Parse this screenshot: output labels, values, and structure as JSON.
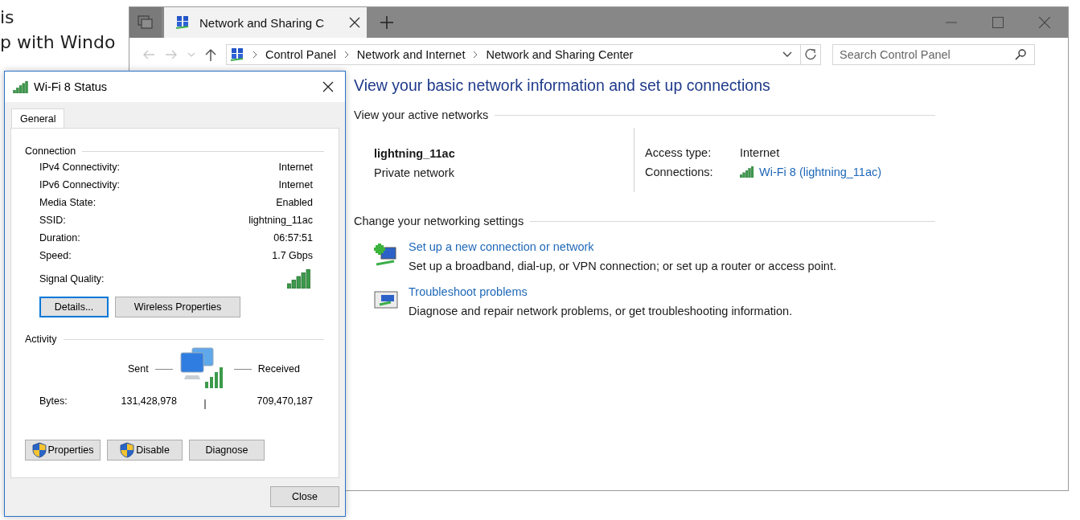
{
  "background_page": {
    "lines": [
      "is",
      "p with Windo"
    ]
  },
  "main_window": {
    "tabs": [
      {
        "label": "Network and Sharing C",
        "selected": true
      }
    ],
    "breadcrumbs": [
      "Control Panel",
      "Network and Internet",
      "Network and Sharing Center"
    ],
    "search": {
      "placeholder": "Search Control Panel"
    },
    "heading": "View your basic network information and set up connections",
    "active_networks": {
      "title": "View your active networks",
      "network_name": "lightning_11ac",
      "network_type": "Private network",
      "access_type_label": "Access type:",
      "access_type": "Internet",
      "connections_label": "Connections:",
      "connection_link": "Wi-Fi 8 (lightning_11ac)"
    },
    "settings": {
      "title": "Change your networking settings",
      "items": [
        {
          "kind": "new-connection",
          "link": "Set up a new connection or network",
          "description": "Set up a broadband, dial-up, or VPN connection; or set up a router or access point."
        },
        {
          "kind": "troubleshoot",
          "link": "Troubleshoot problems",
          "description": "Diagnose and repair network problems, or get troubleshooting information."
        }
      ]
    }
  },
  "status_dialog": {
    "title": "Wi-Fi 8 Status",
    "tabs": [
      {
        "label": "General",
        "selected": true
      }
    ],
    "connection": {
      "title": "Connection",
      "rows": [
        {
          "label": "IPv4 Connectivity:",
          "value": "Internet"
        },
        {
          "label": "IPv6 Connectivity:",
          "value": "Internet"
        },
        {
          "label": "Media State:",
          "value": "Enabled"
        },
        {
          "label": "SSID:",
          "value": "lightning_11ac"
        },
        {
          "label": "Duration:",
          "value": "06:57:51"
        },
        {
          "label": "Speed:",
          "value": "1.7 Gbps"
        }
      ],
      "signal_label": "Signal Quality:",
      "buttons": [
        {
          "label": "Details...",
          "focused": true
        },
        {
          "label": "Wireless Properties",
          "focused": false
        }
      ]
    },
    "activity": {
      "title": "Activity",
      "sent_label": "Sent",
      "received_label": "Received",
      "bytes_label": "Bytes:",
      "bytes_sent": "131,428,978",
      "bytes_received": "709,470,187"
    },
    "action_buttons": [
      {
        "label": "Properties",
        "shield": true
      },
      {
        "label": "Disable",
        "shield": true
      },
      {
        "label": "Diagnose",
        "shield": false
      }
    ],
    "close_button": "Close"
  }
}
